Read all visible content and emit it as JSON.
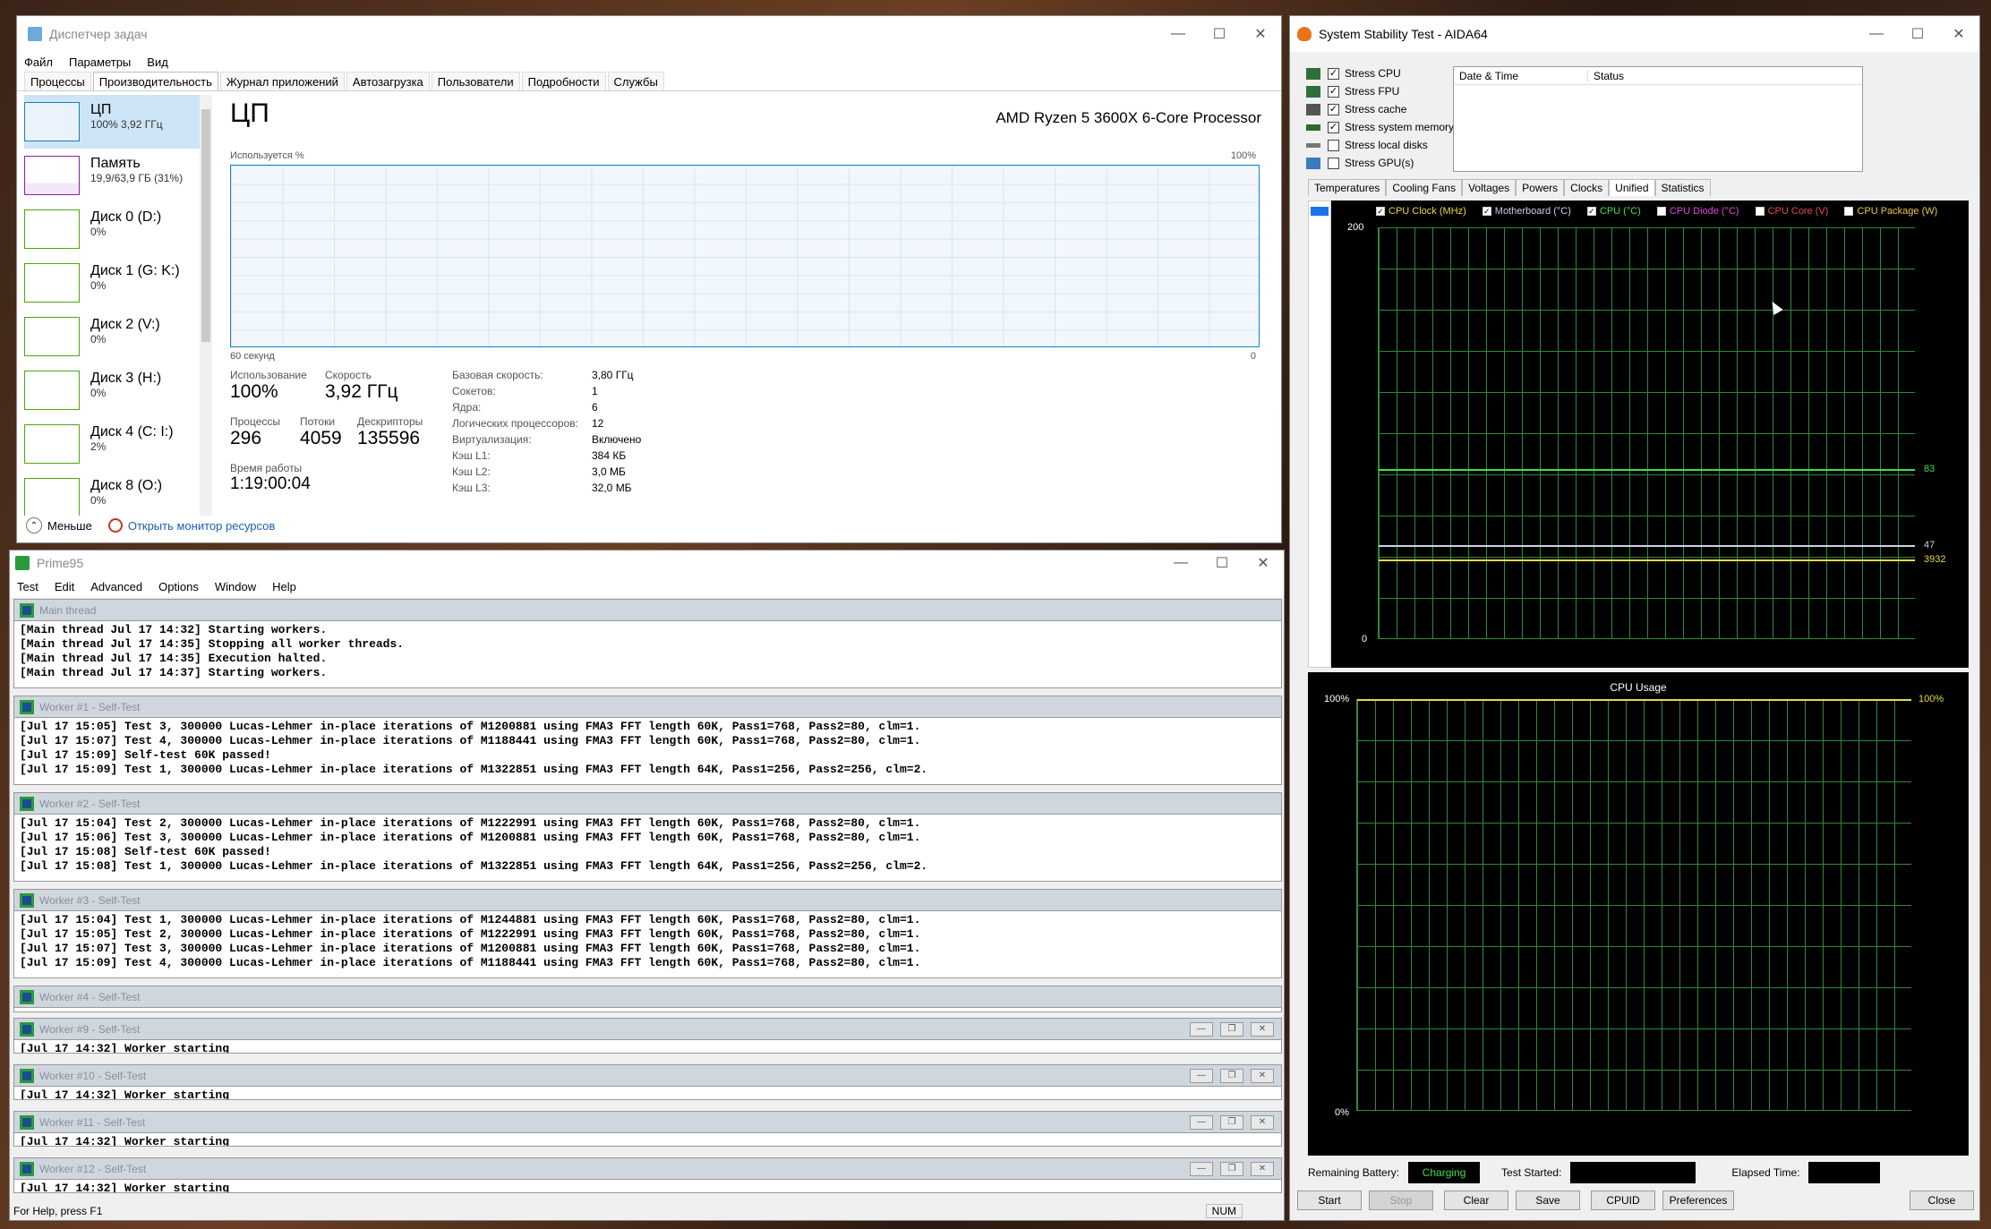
{
  "taskmgr": {
    "title": "Диспетчер задач",
    "menu": [
      "Файл",
      "Параметры",
      "Вид"
    ],
    "tabs": [
      "Процессы",
      "Производительность",
      "Журнал приложений",
      "Автозагрузка",
      "Пользователи",
      "Подробности",
      "Службы"
    ],
    "side": [
      {
        "name": "ЦП",
        "val": "100% 3,92 ГГц",
        "color": "#1b7dc0"
      },
      {
        "name": "Память",
        "val": "19,9/63,9 ГБ (31%)",
        "color": "#8b1fa8"
      },
      {
        "name": "Диск 0 (D:)",
        "val": "0%",
        "color": "#4da60c"
      },
      {
        "name": "Диск 1 (G: K:)",
        "val": "0%",
        "color": "#4da60c"
      },
      {
        "name": "Диск 2 (V:)",
        "val": "0%",
        "color": "#4da60c"
      },
      {
        "name": "Диск 3 (H:)",
        "val": "0%",
        "color": "#4da60c"
      },
      {
        "name": "Диск 4 (C: I:)",
        "val": "2%",
        "color": "#4da60c"
      },
      {
        "name": "Диск 8 (O:)",
        "val": "0%",
        "color": "#4da60c"
      }
    ],
    "cpu_title": "ЦП",
    "processor": "AMD Ryzen 5 3600X 6-Core Processor",
    "util_label": "Используется %",
    "max_label": "100%",
    "time_label": "60 секунд",
    "zero_label": "0",
    "stats": {
      "usage_l": "Использование",
      "usage_v": "100%",
      "speed_l": "Скорость",
      "speed_v": "3,92 ГГц",
      "proc_l": "Процессы",
      "proc_v": "296",
      "thr_l": "Потоки",
      "thr_v": "4059",
      "desc_l": "Дескрипторы",
      "desc_v": "135596",
      "up_l": "Время работы",
      "up_v": "1:19:00:04"
    },
    "kv": [
      [
        "Базовая скорость:",
        "3,80 ГГц"
      ],
      [
        "Сокетов:",
        "1"
      ],
      [
        "Ядра:",
        "6"
      ],
      [
        "Логических процессоров:",
        "12"
      ],
      [
        "Виртуализация:",
        "Включено"
      ],
      [
        "Кэш L1:",
        "384 КБ"
      ],
      [
        "Кэш L2:",
        "3,0 МБ"
      ],
      [
        "Кэш L3:",
        "32,0 МБ"
      ]
    ],
    "less": "Меньше",
    "monitor": "Открыть монитор ресурсов"
  },
  "prime": {
    "title": "Prime95",
    "menu": [
      "Test",
      "Edit",
      "Advanced",
      "Options",
      "Window",
      "Help"
    ],
    "main_title": "Main thread",
    "main_log": "[Main thread Jul 17 14:32] Starting workers.\n[Main thread Jul 17 14:35] Stopping all worker threads.\n[Main thread Jul 17 14:35] Execution halted.\n[Main thread Jul 17 14:37] Starting workers.",
    "w1_title": "Worker #1 - Self-Test",
    "w1_log": "[Jul 17 15:05] Test 3, 300000 Lucas-Lehmer in-place iterations of M1200881 using FMA3 FFT length 60K, Pass1=768, Pass2=80, clm=1.\n[Jul 17 15:07] Test 4, 300000 Lucas-Lehmer in-place iterations of M1188441 using FMA3 FFT length 60K, Pass1=768, Pass2=80, clm=1.\n[Jul 17 15:09] Self-test 60K passed!\n[Jul 17 15:09] Test 1, 300000 Lucas-Lehmer in-place iterations of M1322851 using FMA3 FFT length 64K, Pass1=256, Pass2=256, clm=2.",
    "w2_title": "Worker #2 - Self-Test",
    "w2_log": "[Jul 17 15:04] Test 2, 300000 Lucas-Lehmer in-place iterations of M1222991 using FMA3 FFT length 60K, Pass1=768, Pass2=80, clm=1.\n[Jul 17 15:06] Test 3, 300000 Lucas-Lehmer in-place iterations of M1200881 using FMA3 FFT length 60K, Pass1=768, Pass2=80, clm=1.\n[Jul 17 15:08] Self-test 60K passed!\n[Jul 17 15:08] Test 1, 300000 Lucas-Lehmer in-place iterations of M1322851 using FMA3 FFT length 64K, Pass1=256, Pass2=256, clm=2.",
    "w3_title": "Worker #3 - Self-Test",
    "w3_log": "[Jul 17 15:04] Test 1, 300000 Lucas-Lehmer in-place iterations of M1244881 using FMA3 FFT length 60K, Pass1=768, Pass2=80, clm=1.\n[Jul 17 15:05] Test 2, 300000 Lucas-Lehmer in-place iterations of M1222991 using FMA3 FFT length 60K, Pass1=768, Pass2=80, clm=1.\n[Jul 17 15:07] Test 3, 300000 Lucas-Lehmer in-place iterations of M1200881 using FMA3 FFT length 60K, Pass1=768, Pass2=80, clm=1.\n[Jul 17 15:09] Test 4, 300000 Lucas-Lehmer in-place iterations of M1188441 using FMA3 FFT length 60K, Pass1=768, Pass2=80, clm=1.",
    "w4_title": "Worker #4 - Self-Test",
    "w9_title": "Worker #9 - Self-Test",
    "w10_title": "Worker #10 - Self-Test",
    "w11_title": "Worker #11 - Self-Test",
    "w12_title": "Worker #12 - Self-Test",
    "starting": "[Jul 17 14:32] Worker starting",
    "status_help": "For Help, press F1",
    "status_num": "NUM"
  },
  "aida": {
    "title": "System Stability Test - AIDA64",
    "checks": [
      {
        "label": "Stress CPU",
        "checked": true
      },
      {
        "label": "Stress FPU",
        "checked": true
      },
      {
        "label": "Stress cache",
        "checked": true
      },
      {
        "label": "Stress system memory",
        "checked": true
      },
      {
        "label": "Stress local disks",
        "checked": false
      },
      {
        "label": "Stress GPU(s)",
        "checked": false
      }
    ],
    "col_date": "Date & Time",
    "col_status": "Status",
    "tabs": [
      "Temperatures",
      "Cooling Fans",
      "Voltages",
      "Powers",
      "Clocks",
      "Unified",
      "Statistics"
    ],
    "legend": [
      {
        "label": "CPU Clock (MHz)",
        "color": "#e8d84a",
        "checked": true
      },
      {
        "label": "Motherboard (°C)",
        "color": "#c9d2e8",
        "checked": true
      },
      {
        "label": "CPU (°C)",
        "color": "#3ee04a",
        "checked": true
      },
      {
        "label": "CPU Diode (°C)",
        "color": "#d84ad8",
        "checked": false
      },
      {
        "label": "CPU Core (V)",
        "color": "#e84a4a",
        "checked": false
      },
      {
        "label": "CPU Package (W)",
        "color": "#e8c84a",
        "checked": false
      }
    ],
    "g1_top": "200",
    "g1_bottom": "0",
    "v83": "83",
    "v47": "47",
    "v3932": "3932",
    "g2_title": "CPU Usage",
    "g2_top": "100%",
    "g2_bottom": "0%",
    "g2_right": "100%",
    "rb_label": "Remaining Battery:",
    "rb_value": "Charging",
    "ts_label": "Test Started:",
    "et_label": "Elapsed Time:",
    "buttons": [
      "Start",
      "Stop",
      "Clear",
      "Save",
      "CPUID",
      "Preferences",
      "Close"
    ]
  }
}
